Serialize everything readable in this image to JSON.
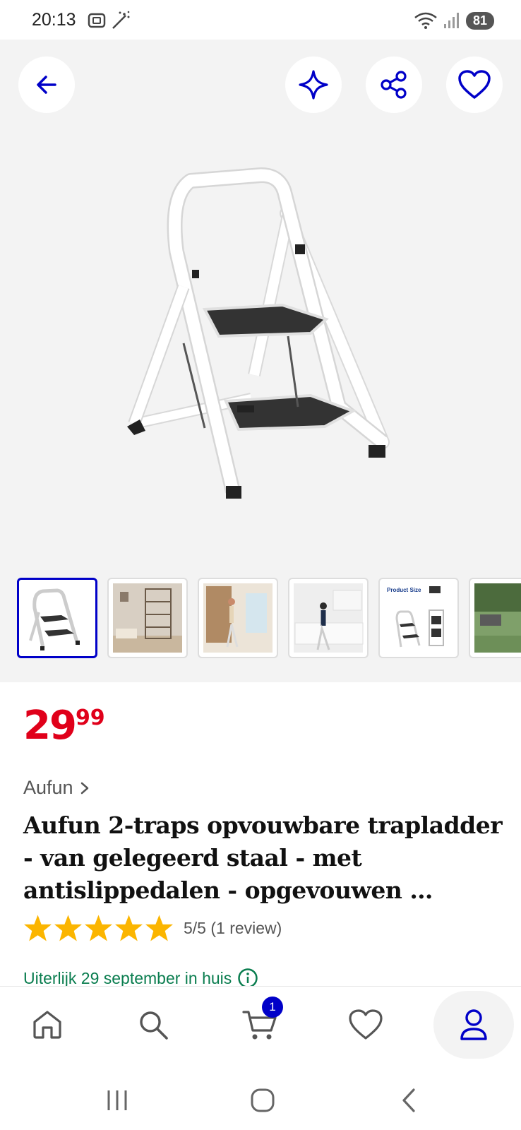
{
  "status_bar": {
    "time": "20:13",
    "battery": "81"
  },
  "header": {
    "back_icon": "arrow-left-icon",
    "ai_icon": "sparkle-icon",
    "share_icon": "share-icon",
    "favorite_icon": "heart-icon"
  },
  "gallery": {
    "thumbnail_count": 6,
    "active_index": 0,
    "thumb_5_caption": "Product Size"
  },
  "product": {
    "price_whole": "29",
    "price_fraction": "99",
    "brand": "Aufun",
    "title": "Aufun 2-traps opvouwbare trapladder - van gelegeerd staal - met antislippedalen - opgevouwen …",
    "rating_stars": 5,
    "rating_text": "5/5 (1 review)",
    "delivery": "Uiterlijk 29 september in huis"
  },
  "bottom_nav": {
    "cart_badge": "1",
    "items": [
      "home-icon",
      "search-icon",
      "cart-icon",
      "heart-icon",
      "account-icon"
    ]
  },
  "colors": {
    "accent": "#0000c8",
    "price": "#e0001a",
    "rating": "#fbb500",
    "delivery": "#0a7d4f"
  }
}
